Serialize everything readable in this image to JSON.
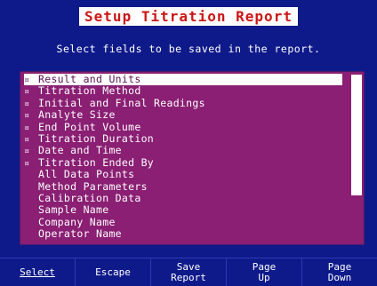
{
  "header": {
    "title": "Setup Titration Report",
    "instruction": "Select fields to be saved in the report."
  },
  "fields": [
    {
      "label": "Result and Units",
      "checked": true,
      "selected": true
    },
    {
      "label": "Titration Method",
      "checked": true,
      "selected": false
    },
    {
      "label": "Initial and Final Readings",
      "checked": true,
      "selected": false
    },
    {
      "label": "Analyte Size",
      "checked": true,
      "selected": false
    },
    {
      "label": "End Point Volume",
      "checked": true,
      "selected": false
    },
    {
      "label": "Titration Duration",
      "checked": true,
      "selected": false
    },
    {
      "label": "Date and Time",
      "checked": true,
      "selected": false
    },
    {
      "label": "Titration Ended By",
      "checked": true,
      "selected": false
    },
    {
      "label": "All Data Points",
      "checked": false,
      "selected": false
    },
    {
      "label": "Method Parameters",
      "checked": false,
      "selected": false
    },
    {
      "label": "Calibration Data",
      "checked": false,
      "selected": false
    },
    {
      "label": "Sample Name",
      "checked": false,
      "selected": false
    },
    {
      "label": "Company Name",
      "checked": false,
      "selected": false
    },
    {
      "label": "Operator Name",
      "checked": false,
      "selected": false
    }
  ],
  "check_mark": "¤",
  "scroll": {
    "position_fraction": 0.72
  },
  "softkeys": [
    {
      "label": "Select",
      "active": true
    },
    {
      "label": "Escape",
      "active": false
    },
    {
      "label": "Save\nReport",
      "active": false
    },
    {
      "label": "Page\nUp",
      "active": false
    },
    {
      "label": "Page\nDown",
      "active": false
    }
  ],
  "colors": {
    "background": "#0f1a8a",
    "list_background": "#8a1f73",
    "title_text": "#cc1616",
    "highlight": "#ffffff"
  }
}
